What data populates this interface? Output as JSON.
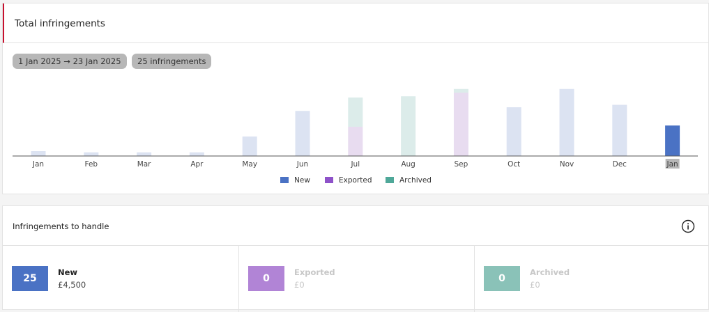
{
  "card": {
    "title": "Total infringements",
    "date_range": "1 Jan 2025 → 23 Jan 2025",
    "count_label": "25 infringements"
  },
  "chart_data": {
    "type": "bar",
    "stacked": true,
    "categories": [
      "Jan",
      "Feb",
      "Mar",
      "Apr",
      "May",
      "Jun",
      "Jul",
      "Aug",
      "Sep",
      "Oct",
      "Nov",
      "Dec",
      "Jan"
    ],
    "highlight_index": 12,
    "series": [
      {
        "name": "New",
        "color": "#4a72c4",
        "values": [
          0,
          0,
          0,
          0,
          0,
          0,
          0,
          0,
          0,
          0,
          0,
          0,
          25
        ]
      },
      {
        "name": "Exported",
        "color": "#8e52c9",
        "values": [
          0,
          0,
          0,
          0,
          0,
          0,
          24,
          0,
          52,
          0,
          0,
          0,
          0
        ]
      },
      {
        "name": "Archived",
        "color": "#4fa899",
        "values": [
          0,
          0,
          0,
          0,
          0,
          0,
          24,
          49,
          3,
          0,
          0,
          0,
          0
        ]
      }
    ],
    "inactive_totals": [
      4,
      3,
      3,
      3,
      16,
      37,
      48,
      49,
      53,
      40,
      55,
      42,
      0
    ],
    "inactive_colors": {
      "New": "#dce3f2",
      "Exported": "#e8dcf0",
      "Archived": "#dcecea"
    },
    "legend": [
      "New",
      "Exported",
      "Archived"
    ],
    "legend_placement": "bottom",
    "grid": false
  },
  "handle": {
    "title": "Infringements to handle",
    "tiles": [
      {
        "count": "25",
        "label": "New",
        "amount": "£4,500",
        "color": "#4a72c4"
      },
      {
        "count": "0",
        "label": "Exported",
        "amount": "£0",
        "color": "#b184d6"
      },
      {
        "count": "0",
        "label": "Archived",
        "amount": "£0",
        "color": "#8ac2b8"
      }
    ]
  }
}
